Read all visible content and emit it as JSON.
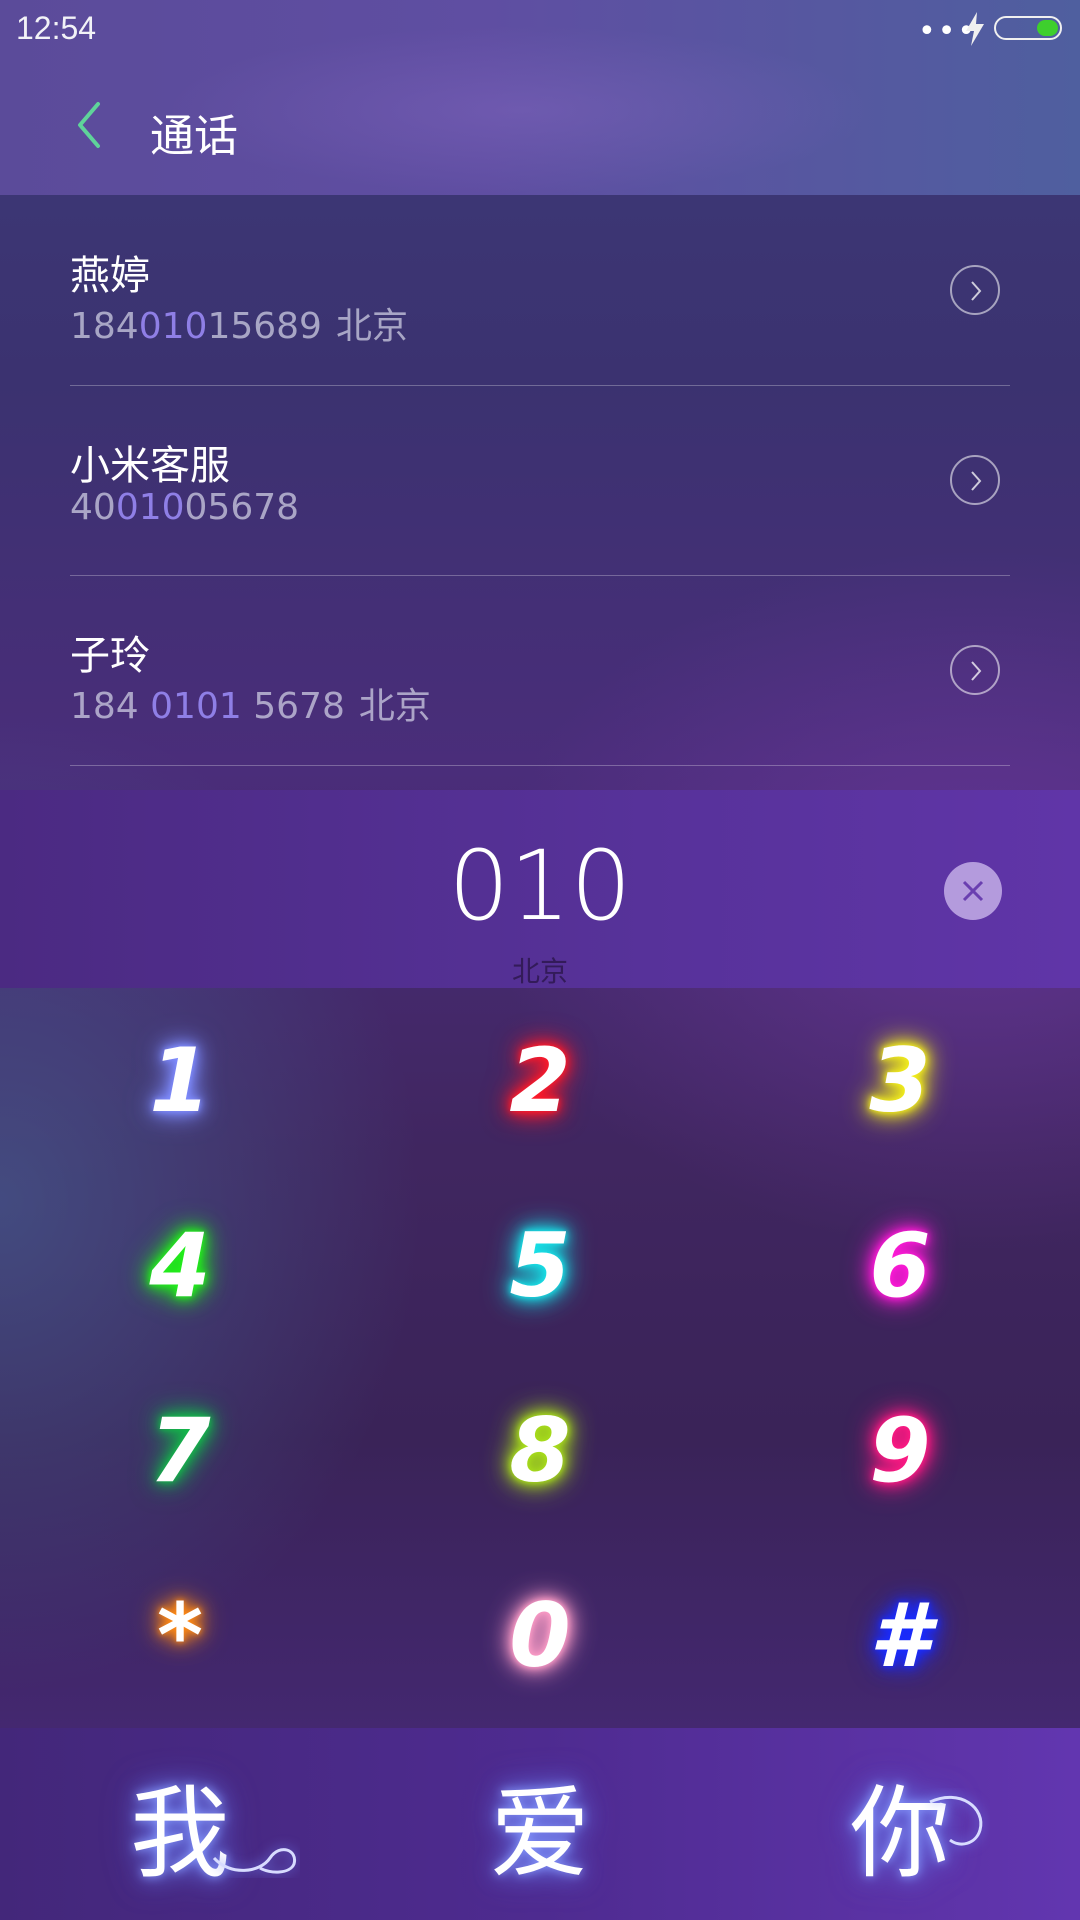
{
  "status_bar": {
    "time": "12:54",
    "more_dots": "•••",
    "battery_level": 0.35,
    "battery_color": "#3ecf2d"
  },
  "header": {
    "title": "通话",
    "accent": "#5fd39a"
  },
  "contacts": [
    {
      "name": "燕婷",
      "number_pre": "184",
      "number_hl": "010",
      "number_post": "15689",
      "location": "北京"
    },
    {
      "name": "小米客服",
      "number_pre": "40",
      "number_hl": "010",
      "number_post": "05678",
      "location": ""
    },
    {
      "name": "子玲",
      "number_pre": "184 ",
      "number_hl": "0101",
      "number_post": " 5678",
      "location": "北京"
    }
  ],
  "dialer": {
    "digits": "010",
    "location": "北京",
    "highlight_color": "#8f7fe6"
  },
  "keypad": [
    {
      "label": "1",
      "glow": "#7f8cff"
    },
    {
      "label": "2",
      "glow": "#ff1a2a"
    },
    {
      "label": "3",
      "glow": "#f4f01a"
    },
    {
      "label": "4",
      "glow": "#22f01a"
    },
    {
      "label": "5",
      "glow": "#17e3e8"
    },
    {
      "label": "6",
      "glow": "#ff1ad8"
    },
    {
      "label": "7",
      "glow": "#14b84a"
    },
    {
      "label": "8",
      "glow": "#a9e01a"
    },
    {
      "label": "9",
      "glow": "#ff1a84"
    },
    {
      "label": "*",
      "glow": "#ff8a14"
    },
    {
      "label": "0",
      "glow": "#ff9ec8"
    },
    {
      "label": "#",
      "glow": "#1a2cff"
    }
  ],
  "actions": [
    {
      "label": "我"
    },
    {
      "label": "爱"
    },
    {
      "label": "你"
    }
  ]
}
